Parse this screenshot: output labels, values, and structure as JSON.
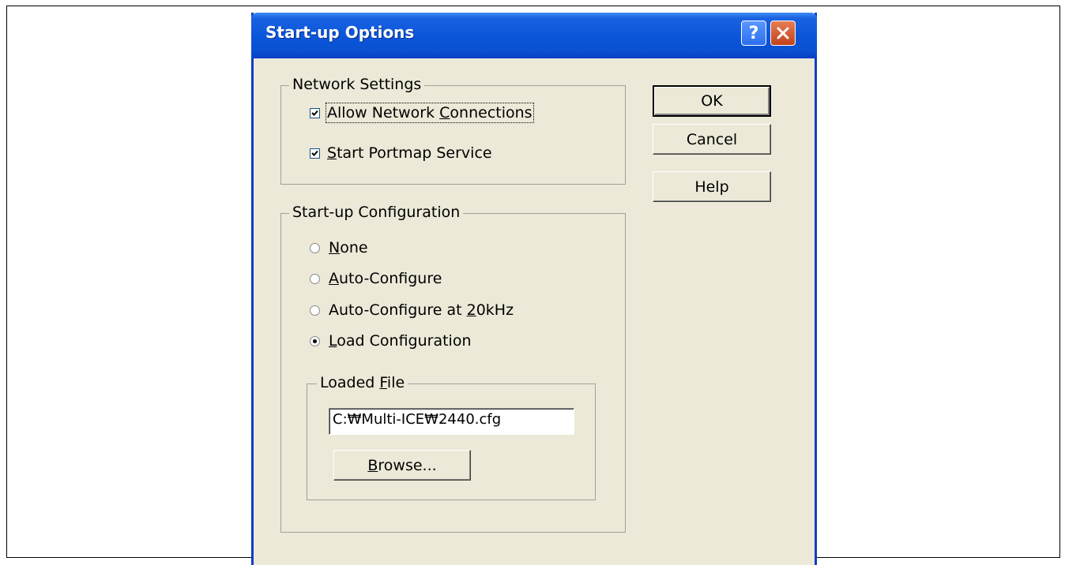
{
  "dialog": {
    "title": "Start-up Options",
    "title_help_label": "?"
  },
  "network_settings": {
    "group_label": "Network Settings",
    "allow_connections": {
      "label_prefix": "Allow Network ",
      "label_mnemonic": "C",
      "label_suffix": "onnections",
      "checked": true
    },
    "start_portmap": {
      "label_prefix": "",
      "label_mnemonic": "S",
      "label_suffix": "tart Portmap Service",
      "checked": true
    }
  },
  "startup_configuration": {
    "group_label": "Start-up Configuration",
    "options": [
      {
        "prefix": "",
        "mnemonic": "N",
        "suffix": "one",
        "selected": false
      },
      {
        "prefix": "",
        "mnemonic": "A",
        "suffix": "uto-Configure",
        "selected": false
      },
      {
        "prefix": "Auto-Configure at ",
        "mnemonic": "2",
        "suffix": "0kHz",
        "selected": false
      },
      {
        "prefix": "",
        "mnemonic": "L",
        "suffix": "oad Configuration",
        "selected": true
      }
    ],
    "loaded_file": {
      "group_label_prefix": "Loaded ",
      "group_label_mnemonic": "F",
      "group_label_suffix": "ile",
      "path": "C:₩Multi-ICE₩2440.cfg",
      "browse_mnemonic": "B",
      "browse_suffix": "rowse..."
    }
  },
  "buttons": {
    "ok": "OK",
    "cancel": "Cancel",
    "help": "Help"
  },
  "colors": {
    "titlebar": "#0a4fd0",
    "dialog_bg": "#ece9d8",
    "close_button": "#c3421b"
  }
}
